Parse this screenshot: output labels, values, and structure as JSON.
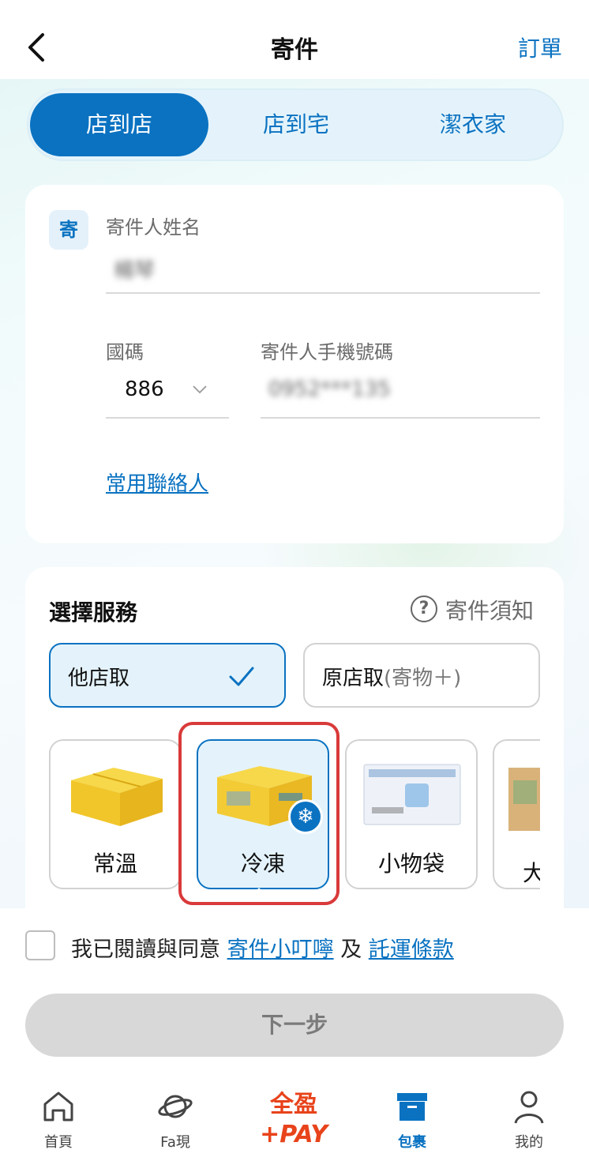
{
  "header": {
    "title": "寄件",
    "orders_label": "訂單"
  },
  "tabs": [
    {
      "label": "店到店",
      "active": true
    },
    {
      "label": "店到宅",
      "active": false
    },
    {
      "label": "潔衣家",
      "active": false
    }
  ],
  "sender": {
    "badge": "寄",
    "name_label": "寄件人姓名",
    "name_value": "楊琴",
    "country_label": "國碼",
    "country_value": "886",
    "phone_label": "寄件人手機號碼",
    "phone_value": "0952***135",
    "contacts_link": "常用聯絡人"
  },
  "service": {
    "title": "選擇服務",
    "notice_label": "寄件須知",
    "pickup_options": [
      {
        "label": "他店取",
        "sub": "",
        "selected": true
      },
      {
        "label": "原店取",
        "sub": "(寄物＋)",
        "selected": false
      }
    ],
    "temperature_options": [
      {
        "label": "常溫"
      },
      {
        "label": "冷凍",
        "selected": true
      },
      {
        "label": "小物袋"
      },
      {
        "label": "大"
      }
    ]
  },
  "footer": {
    "agree_prefix": "我已閱讀與同意",
    "agree_link1": "寄件小叮嚀",
    "agree_and": "及",
    "agree_link2": "託運條款",
    "next_label": "下一步"
  },
  "nav": {
    "home": "首頁",
    "fa": "Fa現",
    "pay_top": "全盈",
    "pay_bottom": "+PAY",
    "package": "包裹",
    "me": "我的"
  },
  "colors": {
    "accent": "#0a72c1",
    "highlight": "#d93a3a",
    "pay_brand": "#e8431b"
  }
}
